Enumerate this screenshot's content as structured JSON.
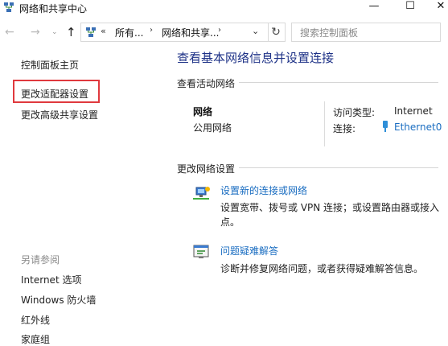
{
  "window": {
    "title": "网络和共享中心",
    "minimize_glyph": "—",
    "maximize_glyph": "☐",
    "close_glyph": "✕"
  },
  "nav": {
    "back_glyph": "←",
    "forward_glyph": "→",
    "history_glyph": "⌄",
    "up_glyph": "↑",
    "address_overflow": "«",
    "address_part1": "所有...",
    "address_separator": "›",
    "address_part2": "网络和共享...",
    "address_dropdown": "⌄",
    "refresh_glyph": "↻",
    "search_placeholder": "搜索控制面板"
  },
  "left_pane": {
    "home": "控制面板主页",
    "change_adapter": "更改适配器设置",
    "change_advanced": "更改高级共享设置",
    "see_also_header": "另请参阅",
    "see_also": [
      "Internet 选项",
      "Windows 防火墙",
      "红外线",
      "家庭组"
    ]
  },
  "main": {
    "title": "查看基本网络信息并设置连接",
    "active_header": "查看活动网络",
    "network": {
      "name": "网络",
      "type": "公用网络",
      "access_label": "访问类型:",
      "access_value": "Internet",
      "connection_label": "连接:",
      "connection_value": "Ethernet0"
    },
    "change_header": "更改网络设置",
    "tasks": [
      {
        "link": "设置新的连接或网络",
        "desc": "设置宽带、拨号或 VPN 连接；或设置路由器或接入点。",
        "icon": "network-setup-icon"
      },
      {
        "link": "问题疑难解答",
        "desc": "诊断并修复网络问题，或者获得疑难解答信息。",
        "icon": "troubleshoot-icon"
      }
    ]
  },
  "colors": {
    "title_blue": "#1e3287",
    "link_blue": "#1a6dc1",
    "highlight_red": "#e0393e"
  }
}
